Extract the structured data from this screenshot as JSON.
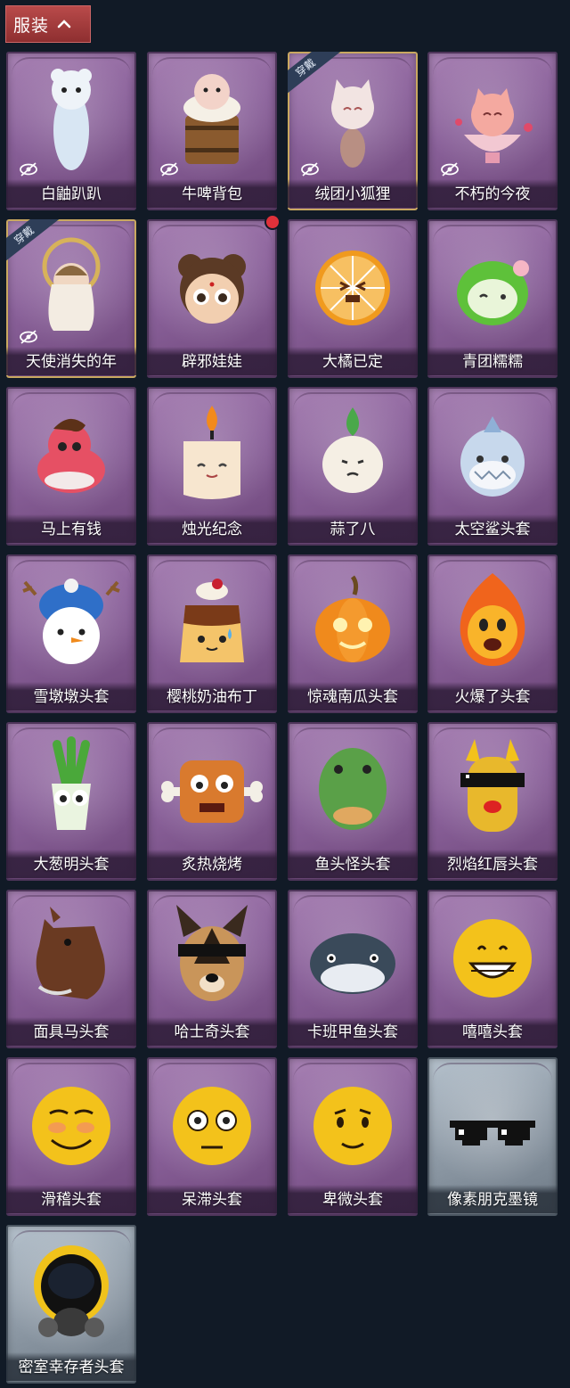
{
  "header": {
    "title": "服装",
    "icon": "chevron-up-icon"
  },
  "badge_text": "穿戴",
  "items": [
    {
      "label": "白鼬趴趴",
      "icon": "ermine-plush-icon",
      "hidden": true
    },
    {
      "label": "牛啤背包",
      "icon": "cow-beer-barrel-backpack-icon",
      "hidden": true
    },
    {
      "label": "绒团小狐狸",
      "icon": "fluffy-fox-icon",
      "hidden": true,
      "equipped": true
    },
    {
      "label": "不朽的今夜",
      "icon": "kitten-teacup-icon",
      "hidden": true
    },
    {
      "label": "天使消失的年",
      "icon": "angel-doll-icon",
      "hidden": true,
      "equipped": true
    },
    {
      "label": "辟邪娃娃",
      "icon": "doll-head-icon",
      "new": true
    },
    {
      "label": "大橘已定",
      "icon": "orange-slice-icon"
    },
    {
      "label": "青团糯糯",
      "icon": "green-rice-ball-icon"
    },
    {
      "label": "马上有钱",
      "icon": "red-horse-icon"
    },
    {
      "label": "烛光纪念",
      "icon": "candle-icon"
    },
    {
      "label": "蒜了八",
      "icon": "garlic-icon"
    },
    {
      "label": "太空鲨头套",
      "icon": "space-shark-icon"
    },
    {
      "label": "雪墩墩头套",
      "icon": "snowman-icon"
    },
    {
      "label": "樱桃奶油布丁",
      "icon": "cherry-pudding-icon"
    },
    {
      "label": "惊魂南瓜头套",
      "icon": "pumpkin-icon"
    },
    {
      "label": "火爆了头套",
      "icon": "fireball-icon"
    },
    {
      "label": "大葱明头套",
      "icon": "green-onion-icon"
    },
    {
      "label": "炙热烧烤",
      "icon": "bbq-meat-icon"
    },
    {
      "label": "鱼头怪头套",
      "icon": "fish-head-icon"
    },
    {
      "label": "烈焰红唇头套",
      "icon": "yellow-mask-sunglasses-icon"
    },
    {
      "label": "面具马头套",
      "icon": "horse-mask-icon"
    },
    {
      "label": "哈士奇头套",
      "icon": "husky-sunglasses-icon"
    },
    {
      "label": "卡班甲鱼头套",
      "icon": "round-fish-icon"
    },
    {
      "label": "嘻嘻头套",
      "icon": "grin-emoji-icon"
    },
    {
      "label": "滑稽头套",
      "icon": "funny-emoji-icon"
    },
    {
      "label": "呆滞头套",
      "icon": "dazed-emoji-icon"
    },
    {
      "label": "卑微头套",
      "icon": "humble-emoji-icon"
    },
    {
      "label": "像素朋克墨镜",
      "icon": "pixel-sunglasses-icon",
      "rarity": "grey"
    },
    {
      "label": "密室幸存者头套",
      "icon": "gas-mask-helmet-icon",
      "rarity": "grey"
    }
  ]
}
